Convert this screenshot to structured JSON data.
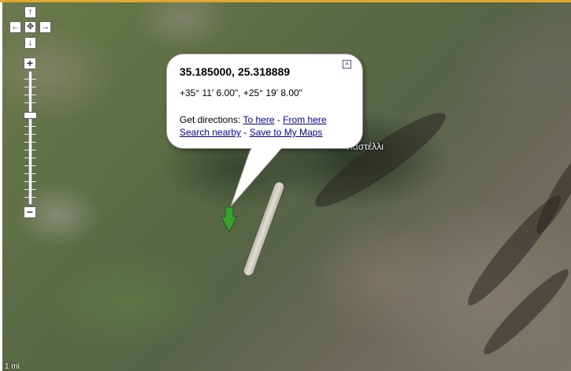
{
  "bubble": {
    "title": "35.185000, 25.318889",
    "dms": "+35° 11' 6.00\", +25° 19' 8.00\"",
    "directions_label": "Get directions:",
    "to_here": "To here",
    "sep1": "-",
    "from_here": "From here",
    "search_nearby": "Search nearby",
    "sep2": "-",
    "save_to_my_maps": "Save to My Maps",
    "close_glyph": "×"
  },
  "map": {
    "place_label": "Καστέλλι",
    "scale_label": "1 mi"
  },
  "controls": {
    "pan_up": "↑",
    "pan_left": "←",
    "pan_center": "✥",
    "pan_right": "→",
    "pan_down": "↓",
    "zoom_in": "+",
    "zoom_out": "−"
  },
  "icons": [
    "arrow-up-icon",
    "arrow-left-icon",
    "pan-center-icon",
    "arrow-right-icon",
    "arrow-down-icon",
    "zoom-in-icon",
    "zoom-out-icon",
    "close-icon",
    "green-arrow-marker-icon"
  ],
  "colors": {
    "marker": "#3c9e2f",
    "link": "#0000cc",
    "top_border": "#e0a82e"
  }
}
